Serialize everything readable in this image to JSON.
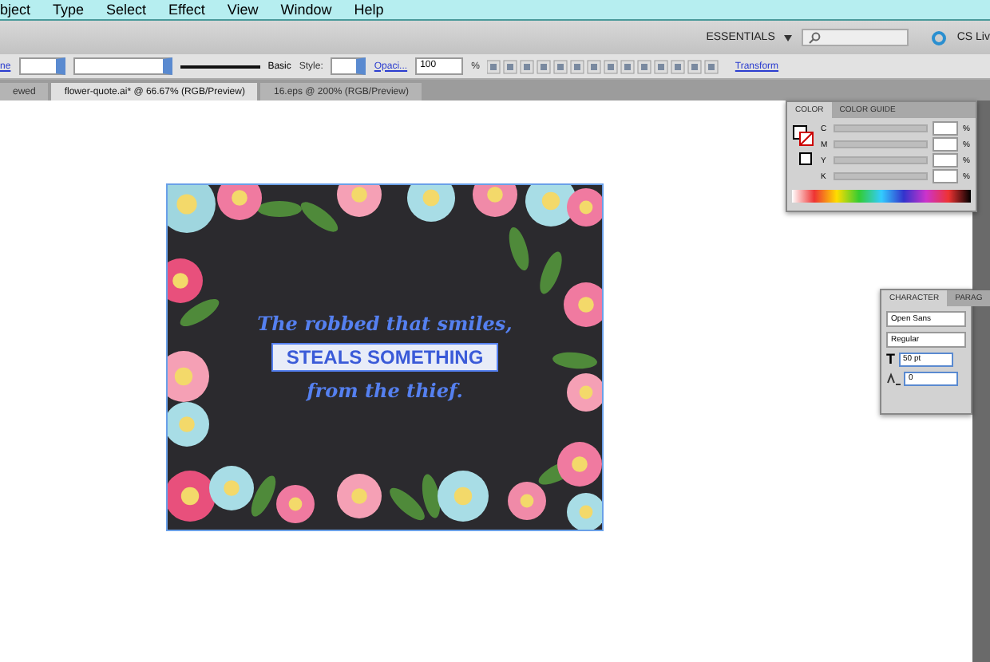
{
  "menu": [
    "bject",
    "Type",
    "Select",
    "Effect",
    "View",
    "Window",
    "Help"
  ],
  "app_bar": {
    "workspace": "ESSENTIALS",
    "cs_live": "CS Liv"
  },
  "control_bar": {
    "stroke_link": "ne",
    "brush": "Basic",
    "style_label": "Style:",
    "opacity_link": "Opaci...",
    "opacity": "100",
    "unit": "%",
    "transform_link": "Transform"
  },
  "tabs": [
    {
      "label": "ewed",
      "selected": false
    },
    {
      "label": "flower-quote.ai* @ 66.67% (RGB/Preview)",
      "selected": true
    },
    {
      "label": "16.eps @ 200% (RGB/Preview)",
      "selected": false
    }
  ],
  "artwork": {
    "line_1": "The robbed that smiles,",
    "banner": "STEALS SOMETHING",
    "line_3": "from the thief."
  },
  "color_panel": {
    "tabs": [
      {
        "label": "COLOR",
        "selected": true
      },
      {
        "label": "COLOR GUIDE",
        "selected": false
      }
    ],
    "channels": [
      {
        "label": "C",
        "level": 0
      },
      {
        "label": "M",
        "level": 0
      },
      {
        "label": "Y",
        "level": 0
      },
      {
        "label": "K",
        "level": 0
      }
    ],
    "unit": "%"
  },
  "character_panel": {
    "tabs": [
      {
        "label": "CHARACTER",
        "selected": true
      },
      {
        "label": "PARAG",
        "selected": false
      }
    ],
    "size_icon": "T",
    "font": "Open Sans",
    "style": "Regular",
    "size": "50 pt",
    "tracking": "0"
  }
}
